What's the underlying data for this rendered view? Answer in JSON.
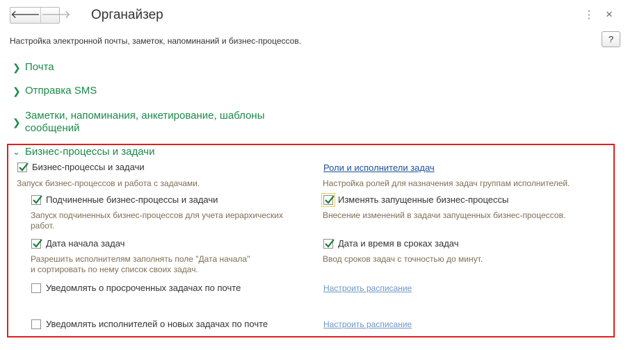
{
  "window": {
    "title": "Органайзер",
    "subtitle": "Настройка электронной почты, заметок, напоминаний и бизнес-процессов.",
    "help": "?",
    "more": "⋮",
    "close": "×",
    "back": "🡐",
    "forward": "🡒"
  },
  "sections": {
    "mail": "Почта",
    "sms": "Отправка SMS",
    "notes_line1": "Заметки, напоминания, анкетирование, шаблоны",
    "notes_line2": "сообщений",
    "bp": "Бизнес-процессы и задачи"
  },
  "bp": {
    "main_cb": "Бизнес-процессы и задачи",
    "main_desc": "Запуск бизнес-процессов и работа с задачами.",
    "roles_link": "Роли и исполнители задач",
    "roles_desc": "Настройка ролей для назначения задач группам исполнителей.",
    "sub_cb": "Подчиненные бизнес-процессы и задачи",
    "sub_desc1": "Запуск подчиненных бизнес-процессов для учета иерархических",
    "sub_desc2": "работ.",
    "change_cb": "Изменять запущенные бизнес-процессы",
    "change_desc": "Внесение изменений в задачи запущенных бизнес-процессов.",
    "start_cb": "Дата начала задач",
    "start_desc1": "Разрешить исполнителям заполнять поле \"Дата начала\"",
    "start_desc2": "и сортировать по нему список своих задач.",
    "datetime_cb": "Дата и время в сроках задач",
    "datetime_desc": "Ввод сроков задач с точностью до минут.",
    "overdue_cb": "Уведомлять о просроченных задачах по почте",
    "schedule1": "Настроить расписание",
    "notify_cb": "Уведомлять исполнителей о новых задачах по почте",
    "schedule2": "Настроить расписание"
  },
  "colors": {
    "section_green": "#1b8a4a",
    "frame_red": "#e01e1e",
    "link_blue": "#1e4f9a",
    "desc_brown": "#7d6f55"
  }
}
